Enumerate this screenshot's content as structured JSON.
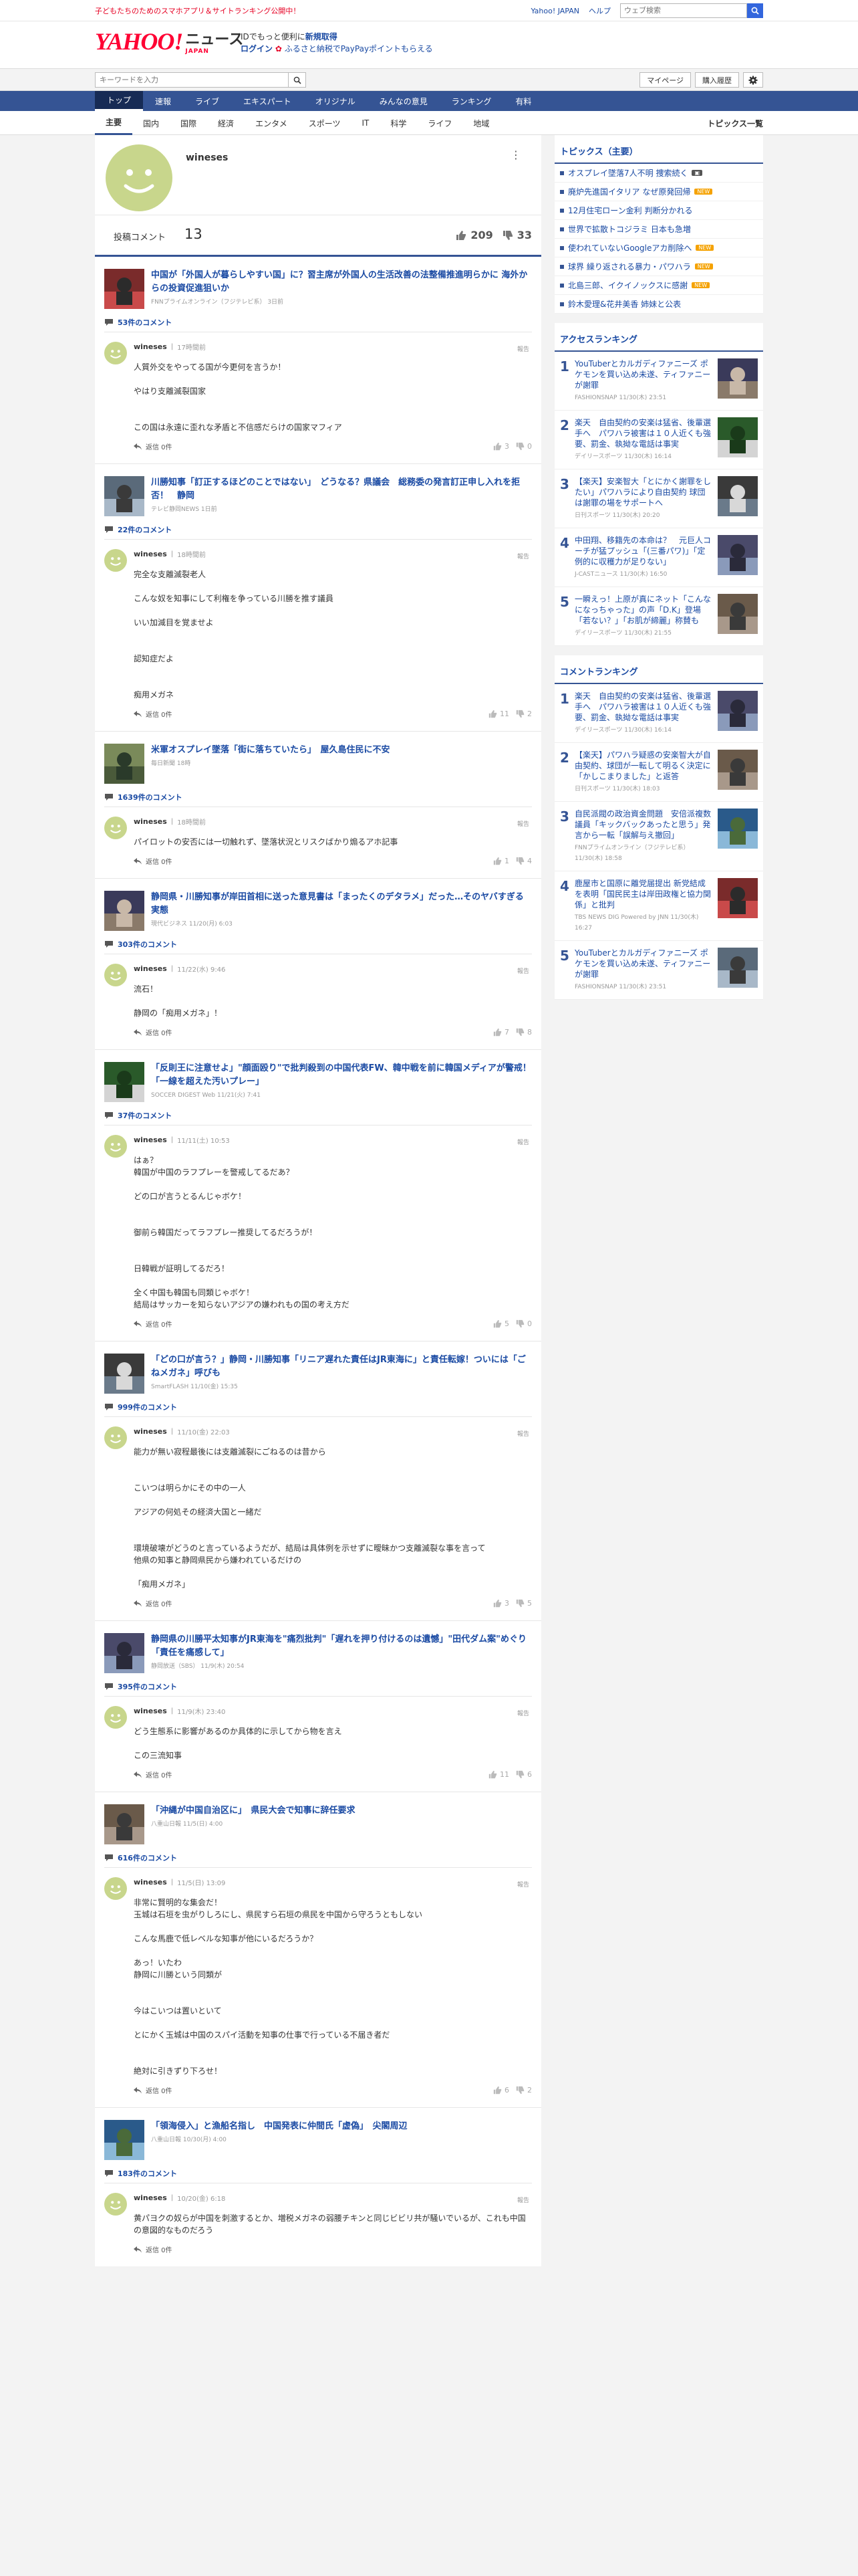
{
  "topbar": {
    "promo": "子どもたちのためのスマホアプリ＆サイトランキング公開中！",
    "links": [
      "Yahoo! JAPAN",
      "ヘルプ"
    ],
    "web_search_placeholder": "ウェブ検索"
  },
  "brand": {
    "logo_main": "YAHOO!",
    "logo_sub": "ニュース",
    "logo_jp": "JAPAN",
    "line1_prefix": "IDでもっと便利に",
    "line1_link": "新規取得",
    "line2_login": "ログイン",
    "line2_text": "ふるさと納税でPayPayポイントもらえる"
  },
  "search": {
    "placeholder": "キーワードを入力",
    "mypage": "マイページ",
    "purchase": "購入履歴"
  },
  "nav_primary": [
    "トップ",
    "速報",
    "ライブ",
    "エキスパート",
    "オリジナル",
    "みんなの意見",
    "ランキング",
    "有料"
  ],
  "nav_secondary": [
    "主要",
    "国内",
    "国際",
    "経済",
    "エンタメ",
    "スポーツ",
    "IT",
    "科学",
    "ライフ",
    "地域"
  ],
  "nav_secondary_all": "トピックス一覧",
  "profile": {
    "username": "wineses",
    "posts_label": "投稿コメント",
    "posts_count": "13",
    "likes": "209",
    "dislikes": "33"
  },
  "articles": [
    {
      "title": "中国が「外国人が暮らしやすい国」に？習主席が外国人の生活改善の法整備推進明らかに 海外からの投資促進狙いか",
      "source": "FNNプライムオンライン（フジテレビ系） 3日前",
      "comment_count": "53件のコメント",
      "user": "wineses",
      "time": "17時間前",
      "body": [
        "人質外交をやってる国が今更何を言うか！",
        "",
        "やはり支離滅裂国家",
        "",
        "",
        "この国は永遠に歪れな矛盾と不信感だらけの国家マフィア"
      ],
      "up": "3",
      "down": "0"
    },
    {
      "title": "川勝知事「訂正するほどのことではない」　どうなる？県議会　総務委の発言訂正申し入れを拒否！　静岡",
      "source": "テレビ静岡NEWS 1日前",
      "comment_count": "22件のコメント",
      "user": "wineses",
      "time": "18時間前",
      "body": [
        "完全な支離滅裂老人",
        "",
        "こんな奴を知事にして利権を争っている川勝を推す議員",
        "",
        "いい加減目を覚ませよ",
        "",
        "",
        "認知症だよ",
        "",
        "",
        "痴用メガネ"
      ],
      "up": "11",
      "down": "2"
    },
    {
      "title": "米軍オスプレイ墜落「街に落ちていたら」　屋久島住民に不安",
      "source": "毎日新聞 18時",
      "comment_count": "1639件のコメント",
      "user": "wineses",
      "time": "18時間前",
      "body": [
        "パイロットの安否には一切触れず、墜落状況とリスクばかり煽るアホ記事"
      ],
      "up": "1",
      "down": "4"
    },
    {
      "title": "静岡県・川勝知事が岸田首相に送った意見書は「まったくのデタラメ」だった…そのヤバすぎる実態",
      "source": "現代ビジネス 11/20(月) 6:03",
      "comment_count": "303件のコメント",
      "user": "wineses",
      "time": "11/22(水) 9:46",
      "body": [
        "流石！",
        "",
        "静岡の「痴用メガネ」！"
      ],
      "up": "7",
      "down": "8"
    },
    {
      "title": "「反則王に注意せよ」\"顔面殴り\"で批判殺到の中国代表FW、韓中戦を前に韓国メディアが警戒！「一線を超えた汚いプレー」",
      "source": "SOCCER DIGEST Web 11/21(火) 7:41",
      "comment_count": "37件のコメント",
      "user": "wineses",
      "time": "11/11(土) 10:53",
      "body": [
        "はぁ？",
        "韓国が中国のラフプレーを警戒してるだあ？",
        "",
        "どの口が言うとるんじゃボケ！",
        "",
        "",
        "御前ら韓国だってラフプレー推奨してるだろうが！",
        "",
        "",
        "日韓戦が証明してるだろ！",
        "",
        "全く中国も韓国も同類じゃボケ！",
        "結局はサッカーを知らないアジアの嫌われもの国の考え方だ"
      ],
      "up": "5",
      "down": "0"
    },
    {
      "title": "「どの口が言う？」静岡・川勝知事「リニア遅れた責任はJR東海に」と責任転嫁！ついには「ごねメガネ」呼びも",
      "source": "SmartFLASH 11/10(金) 15:35",
      "comment_count": "999件のコメント",
      "user": "wineses",
      "time": "11/10(金) 22:03",
      "body": [
        "能力が無い寂程最後には支離滅裂にごねるのは昔から",
        "",
        "",
        "こいつは明らかにその中の一人",
        "",
        "アジアの何処その経済大国と一緒だ",
        "",
        "",
        "環境破壊がどうのと言っているようだが、結局は具体例を示せずに曖昧かつ支離滅裂な事を言って",
        "他県の知事と静岡県民から嫌われているだけの",
        "",
        "「痴用メガネ」"
      ],
      "up": "3",
      "down": "5"
    },
    {
      "title": "静岡県の川勝平太知事がJR東海を\"痛烈批判\"「遅れを押り付けるのは遺憾」\"田代ダム案\"めぐり「責任を痛感して」",
      "source": "静岡放送（SBS） 11/9(木) 20:54",
      "comment_count": "395件のコメント",
      "user": "wineses",
      "time": "11/9(木) 23:40",
      "body": [
        "どう生態系に影響があるのか具体的に示してから物を言え",
        "",
        "この三流知事"
      ],
      "up": "11",
      "down": "6"
    },
    {
      "title": "「沖縄が中国自治区に」　県民大会で知事に辞任要求",
      "source": "八重山日報 11/5(日) 4:00",
      "comment_count": "616件のコメント",
      "user": "wineses",
      "time": "11/5(日) 13:09",
      "body": [
        "非常に賢明的な集会だ！",
        "玉城は石垣を虫がりしろにし、県民すら石垣の県民を中国から守ろうともしない",
        "",
        "こんな馬鹿で低レベルな知事が他にいるだろうか？",
        "",
        "あっ！いたわ",
        "静岡に川勝という同類が",
        "",
        "",
        "今はこいつは置いといて",
        "",
        "とにかく玉城は中国のスパイ活動を知事の仕事で行っている不届き者だ",
        "",
        "",
        "絶対に引きずり下ろせ！"
      ],
      "up": "6",
      "down": "2"
    },
    {
      "title": "「領海侵入」と漁船名指し　中国発表に仲間氏「虚偽」　尖閣周辺",
      "source": "八重山日報 10/30(月) 4:00",
      "comment_count": "183件のコメント",
      "user": "wineses",
      "time": "10/20(金) 6:18",
      "body": [
        "黄パヨクの奴らが中国を刺激するとか、増税メガネの弱腰チキンと同じビビリ共が騒いでいるが、これも中国の意図的なものだろう"
      ],
      "up": "",
      "down": ""
    }
  ],
  "sidebar": {
    "topics_header": "トピックス（主要）",
    "topics": [
      {
        "text": "オスプレイ墜落7人不明 捜索続く",
        "badge": "photo"
      },
      {
        "text": "廃炉先進国イタリア なぜ原発回帰",
        "badge": "new"
      },
      {
        "text": "12月住宅ローン金利 判断分かれる",
        "badge": ""
      },
      {
        "text": "世界で拡散トコジラミ 日本も急増",
        "badge": ""
      },
      {
        "text": "使われていないGoogleアカ削除へ",
        "badge": "new"
      },
      {
        "text": "球界 繰り返される暴力・パワハラ",
        "badge": "new"
      },
      {
        "text": "北島三郎、イクイノックスに感謝",
        "badge": "new"
      },
      {
        "text": "鈴木愛理&花井美香 姉妹と公表",
        "badge": ""
      }
    ],
    "access_header": "アクセスランキング",
    "access": [
      {
        "rank": "1",
        "text": "YouTuberとカルガディファニーズ ポケモンを買い込め未遂、ティファニーが謝罪",
        "src": "FASHIONSNAP 11/30(木) 23:51"
      },
      {
        "rank": "2",
        "text": "楽天　自由契約の安楽は猛省、後輩選手へ　パワハラ被害は１０人近くも強要、罰金、執拗な電話は事実",
        "src": "デイリースポーツ 11/30(木) 16:14"
      },
      {
        "rank": "3",
        "text": "【楽天】安楽智大「とにかく謝罪をしたい」パワハラにより自由契約 球団は謝罪の場をサポートへ",
        "src": "日刊スポーツ 11/30(木) 20:20"
      },
      {
        "rank": "4",
        "text": "中田翔、移籍先の本命は？　元巨人コーチが猛プッシュ「(三番パワ)」「定例的に収穫力が足りない」",
        "src": "J-CASTニュース 11/30(木) 16:50"
      },
      {
        "rank": "5",
        "text": "一瞬えっ！上原が真にネット「こんなになっちゃった」の声「D.K」登場「若ない？」「お肌が締麗」称賛も",
        "src": "デイリースポーツ 11/30(木) 21:55"
      }
    ],
    "comment_header": "コメントランキング",
    "comments": [
      {
        "rank": "1",
        "text": "楽天　自由契約の安楽は猛省、後輩選手へ　パワハラ被害は１０人近くも強要、罰金、執拗な電話は事実",
        "src": "デイリースポーツ 11/30(木) 16:14"
      },
      {
        "rank": "2",
        "text": "【楽天】パワハラ疑惑の安楽智大が自由契約、球団が一転して明るく決定に「かしこまりました」と返答",
        "src": "日刊スポーツ 11/30(木) 18:03"
      },
      {
        "rank": "3",
        "text": "自民派閥の政治資金問題　安倍派複数議員「キックバックあったと思う」発言から一転「誤解与え撤回」",
        "src": "FNNプライムオンライン（フジテレビ系） 11/30(木) 18:58"
      },
      {
        "rank": "4",
        "text": "鹿屋市と国原に離党届提出 新党結成を表明「国民民主は岸田政権と協力関係」と批判",
        "src": "TBS NEWS DIG Powered by JNN 11/30(木) 16:27"
      },
      {
        "rank": "5",
        "text": "YouTuberとカルガディファニーズ ポケモンを買い込め未遂、ティファニーが謝罪",
        "src": "FASHIONSNAP 11/30(木) 23:51"
      }
    ]
  },
  "ui": {
    "report_label": "報告",
    "reply_label": "返信 0件"
  },
  "colors": {
    "nav_blue": "#355494",
    "link_blue": "#1a4aa3",
    "brand_red": "#ff0033",
    "avatar_green": "#c8d68c"
  }
}
